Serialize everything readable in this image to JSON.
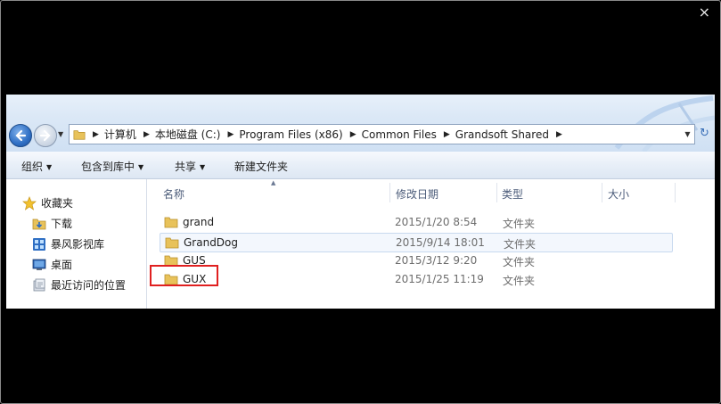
{
  "window": {
    "close_glyph": "×"
  },
  "address_bar": {
    "crumbs": [
      "计算机",
      "本地磁盘 (C:)",
      "Program Files (x86)",
      "Common Files",
      "Grandsoft Shared"
    ]
  },
  "toolbar": {
    "organize": "组织",
    "include_in_library": "包含到库中",
    "share": "共享",
    "new_folder": "新建文件夹"
  },
  "sidebar": {
    "favorites": "收藏夹",
    "items": [
      {
        "label": "下载",
        "icon": "download-folder-icon"
      },
      {
        "label": "暴风影视库",
        "icon": "media-library-icon"
      },
      {
        "label": "桌面",
        "icon": "desktop-icon"
      },
      {
        "label": "最近访问的位置",
        "icon": "recent-places-icon"
      }
    ]
  },
  "columns": {
    "name": "名称",
    "date": "修改日期",
    "type": "类型",
    "size": "大小"
  },
  "files": [
    {
      "name": "grand",
      "date": "2015/1/20 8:54",
      "type": "文件夹"
    },
    {
      "name": "GrandDog",
      "date": "2015/9/14 18:01",
      "type": "文件夹"
    },
    {
      "name": "GUS",
      "date": "2015/3/12 9:20",
      "type": "文件夹"
    },
    {
      "name": "GUX",
      "date": "2015/1/25 11:19",
      "type": "文件夹"
    }
  ],
  "colors": {
    "highlight_box": "#e02020",
    "selection_bg": "#f3f7fd",
    "folder": "#e8c25a"
  }
}
